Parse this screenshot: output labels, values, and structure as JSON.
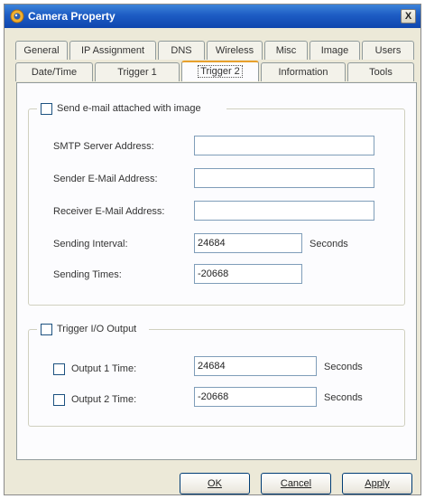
{
  "window": {
    "title": "Camera Property",
    "close_label": "X"
  },
  "tabs_row1": [
    "General",
    "IP Assignment",
    "DNS",
    "Wireless",
    "Misc",
    "Image",
    "Users"
  ],
  "tabs_row2": [
    "Date/Time",
    "Trigger 1",
    "Trigger 2",
    "Information",
    "Tools"
  ],
  "active_tab": "Trigger 2",
  "email": {
    "checkbox_label": "Send e-mail attached with image",
    "checked": false,
    "smtp_label": "SMTP Server Address:",
    "smtp_value": "",
    "sender_label": "Sender E-Mail Address:",
    "sender_value": "",
    "receiver_label": "Receiver E-Mail Address:",
    "receiver_value": "",
    "interval_label": "Sending Interval:",
    "interval_value": "24684",
    "interval_unit": "Seconds",
    "times_label": "Sending Times:",
    "times_value": "-20668"
  },
  "io": {
    "checkbox_label": "Trigger I/O Output",
    "checked": false,
    "output1_label": "Output 1 Time:",
    "output1_value": "24684",
    "output1_unit": "Seconds",
    "output2_label": "Output 2 Time:",
    "output2_value": "-20668",
    "output2_unit": "Seconds"
  },
  "buttons": {
    "ok": "OK",
    "cancel": "Cancel",
    "apply": "Apply"
  }
}
